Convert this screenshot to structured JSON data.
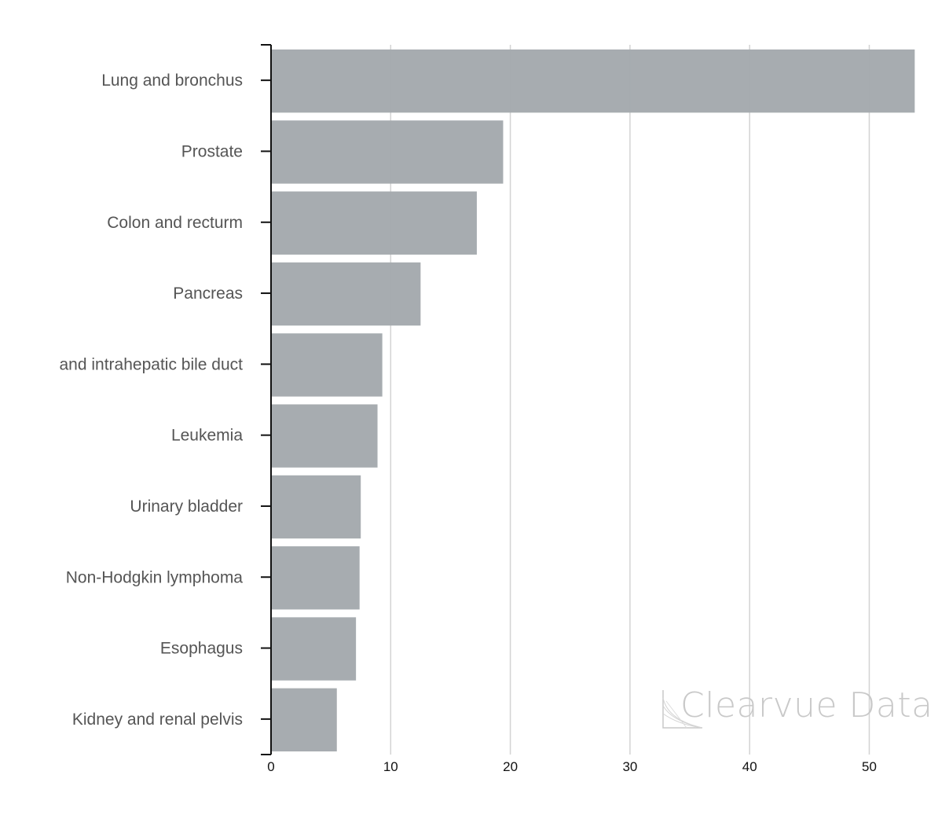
{
  "chart_data": {
    "type": "bar",
    "orientation": "horizontal",
    "title": "",
    "xlabel": "",
    "ylabel": "",
    "categories": [
      "Lung and bronchus",
      "Prostate",
      "Colon and recturm",
      "Pancreas",
      "and intrahepatic bile duct",
      "Leukemia",
      "Urinary bladder",
      "Non-Hodgkin lymphoma",
      "Esophagus",
      "Kidney and renal pelvis"
    ],
    "values": [
      53.8,
      19.4,
      17.2,
      12.5,
      9.3,
      8.9,
      7.5,
      7.4,
      7.1,
      5.5
    ],
    "xlim": [
      0,
      55
    ],
    "xticks": [
      0,
      10,
      20,
      30,
      40,
      50
    ],
    "xtick_labels": [
      "0",
      "10",
      "20",
      "30",
      "40",
      "50"
    ],
    "grid": true,
    "legend": "none",
    "bar_color": "#a4a9ad",
    "grid_color": "#d3d3d3",
    "axis_color": "#111111"
  },
  "watermark": {
    "text": "Clearvue Data",
    "icon": "clearvue-logo-icon"
  }
}
